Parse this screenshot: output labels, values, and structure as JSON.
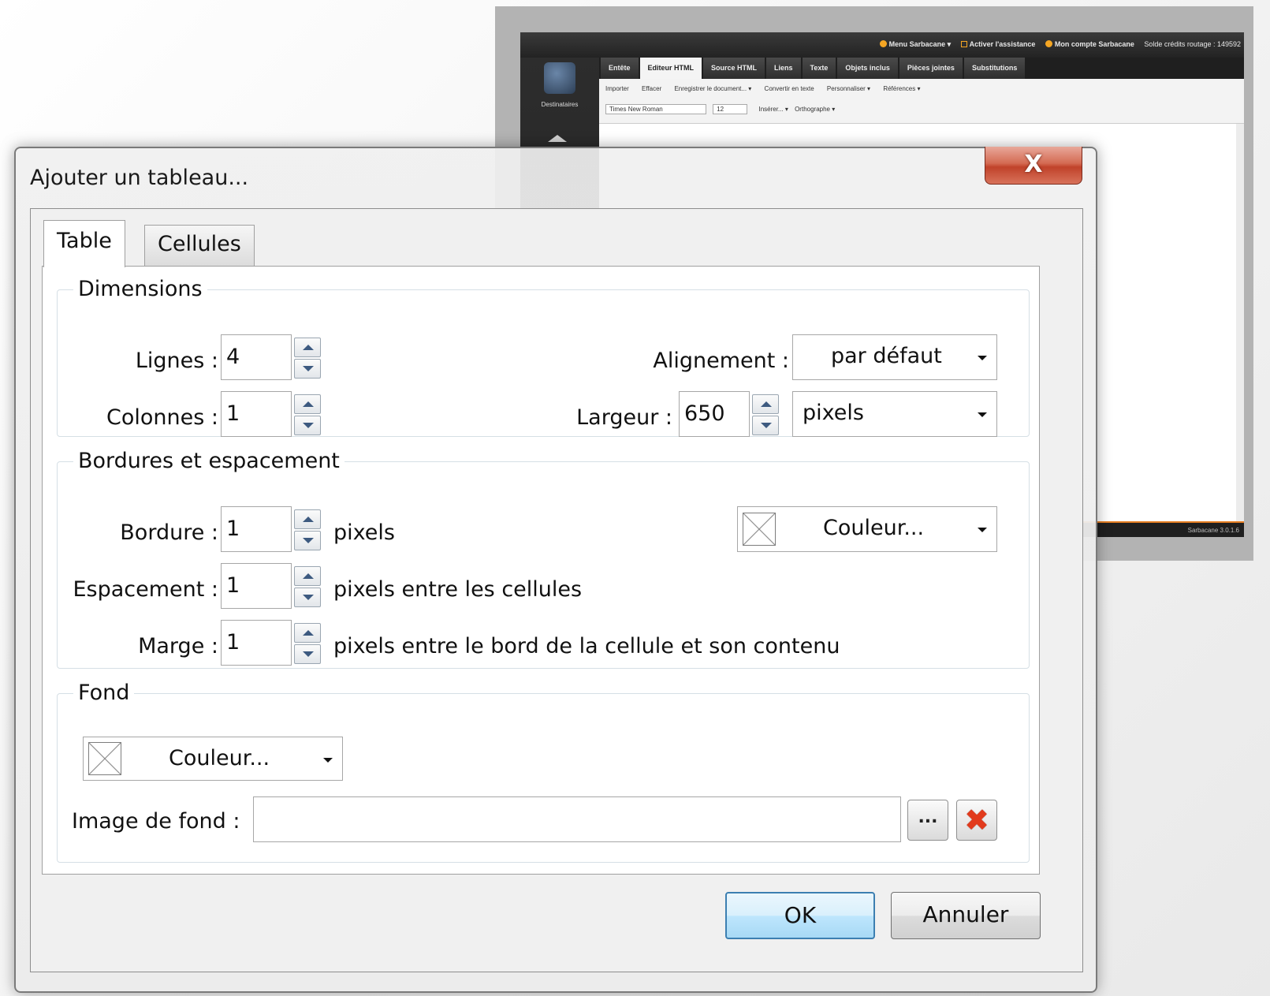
{
  "background_app": {
    "topbar_items": [
      "Menu Sarbacane ▾",
      "Activer l'assistance",
      "Mon compte Sarbacane",
      "Solde crédits routage : 149592"
    ],
    "left_label": "Destinataires",
    "tabs": [
      "Entête",
      "Editeur HTML",
      "Source HTML",
      "Liens",
      "Texte",
      "Objets inclus",
      "Pièces jointes",
      "Substitutions"
    ],
    "active_tab": "Editeur HTML",
    "toolbar_row1": [
      "Importer",
      "Effacer",
      "Enregistrer le document... ▾",
      "Convertir en texte",
      "Personnaliser ▾",
      "Références ▾"
    ],
    "toolbar_font": "Times New Roman",
    "toolbar_size": "12",
    "toolbar_row2_extra": [
      "Insérer... ▾",
      "Orthographe ▾"
    ],
    "status_text": "Sarbacane 3.0.1.6"
  },
  "dialog": {
    "title": "Ajouter un tableau...",
    "close_glyph": "X",
    "tabs": {
      "table": "Table",
      "cells": "Cellules"
    },
    "dimensions": {
      "legend": "Dimensions",
      "rows_label": "Lignes :",
      "rows_value": "4",
      "cols_label": "Colonnes :",
      "cols_value": "1",
      "align_label": "Alignement :",
      "align_value": "par défaut",
      "width_label": "Largeur :",
      "width_value": "650",
      "width_unit": "pixels"
    },
    "borders": {
      "legend": "Bordures et espacement",
      "border_label": "Bordure :",
      "border_value": "1",
      "border_suffix": "pixels",
      "color_button": "Couleur...",
      "spacing_label": "Espacement :",
      "spacing_value": "1",
      "spacing_suffix": "pixels entre les cellules",
      "margin_label": "Marge :",
      "margin_value": "1",
      "margin_suffix": "pixels entre le bord de la cellule et son contenu"
    },
    "background": {
      "legend": "Fond",
      "color_button": "Couleur...",
      "image_label": "Image de fond :",
      "image_value": "",
      "browse_label": "...",
      "clear_glyph": "✖"
    },
    "ok_label": "OK",
    "cancel_label": "Annuler"
  }
}
